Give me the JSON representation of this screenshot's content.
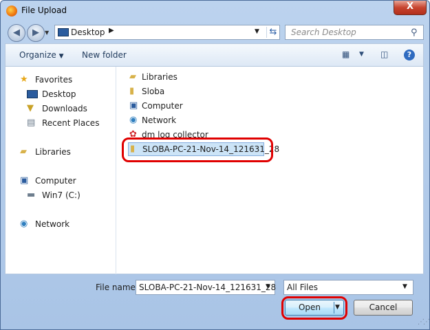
{
  "window": {
    "title": "File Upload",
    "close_label": "X"
  },
  "address_bar": {
    "path": "Desktop"
  },
  "search": {
    "placeholder": "Search Desktop"
  },
  "toolbar": {
    "organize_label": "Organize",
    "new_folder_label": "New folder"
  },
  "nav_pane": {
    "groups": [
      {
        "label": "Favorites",
        "icon": "star-icon",
        "children": [
          {
            "label": "Desktop",
            "icon": "desktop-icon"
          },
          {
            "label": "Downloads",
            "icon": "downloads-icon"
          },
          {
            "label": "Recent Places",
            "icon": "recent-places-icon"
          }
        ]
      },
      {
        "label": "Libraries",
        "icon": "libraries-icon",
        "children": []
      },
      {
        "label": "Computer",
        "icon": "computer-icon",
        "children": [
          {
            "label": "Win7 (C:)",
            "icon": "drive-icon"
          }
        ]
      },
      {
        "label": "Network",
        "icon": "network-icon",
        "children": []
      }
    ]
  },
  "file_list": {
    "items": [
      {
        "label": "Libraries",
        "icon": "libraries-icon"
      },
      {
        "label": "Sloba",
        "icon": "user-folder-icon"
      },
      {
        "label": "Computer",
        "icon": "computer-icon"
      },
      {
        "label": "Network",
        "icon": "network-icon"
      },
      {
        "label": "dm log collector",
        "icon": "app-icon"
      },
      {
        "label": "SLOBA-PC-21-Nov-14_121631_28",
        "icon": "zip-folder-icon",
        "selected": true
      }
    ]
  },
  "bottom": {
    "file_name_label": "File name:",
    "file_name_value": "SLOBA-PC-21-Nov-14_121631_28",
    "filter_value": "All Files",
    "open_label": "Open",
    "cancel_label": "Cancel"
  },
  "colors": {
    "highlight": "#e00000",
    "selection": "#cce4f7"
  }
}
